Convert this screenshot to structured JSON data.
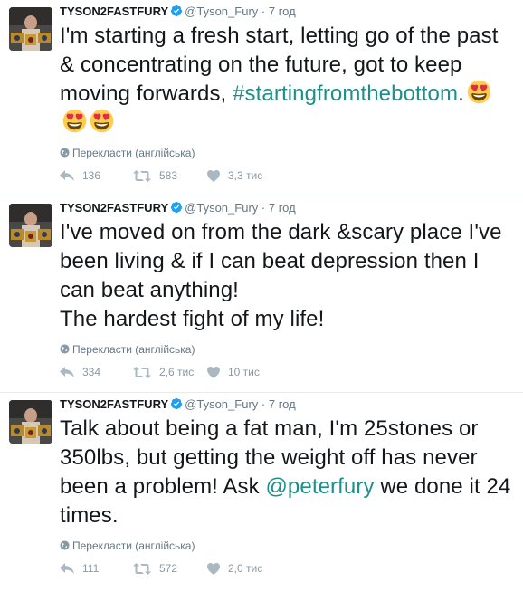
{
  "tweets": [
    {
      "name": "TYSON2FASTFURY",
      "handle": "@Tyson_Fury",
      "sep": "·",
      "time": "7 год",
      "text_before": "I'm starting a fresh start, letting go of the past & concentrating on the future, got to keep moving forwards, ",
      "hashtag": "#startingfromthebottom",
      "text_after": ".",
      "emoji_count": 3,
      "emoji": "smiling-face-with-heart-eyes",
      "translate": "Перекласти (англійська)",
      "replies": "136",
      "retweets": "583",
      "likes": "3,3 тис"
    },
    {
      "name": "TYSON2FASTFURY",
      "handle": "@Tyson_Fury",
      "sep": "·",
      "time": "7 год",
      "line1": "I've moved on from the dark &scary place I've been living & if I can beat depression then I can beat anything!",
      "line2": "The hardest fight of my life!",
      "translate": "Перекласти (англійська)",
      "replies": "334",
      "retweets": "2,6 тис",
      "likes": "10 тис"
    },
    {
      "name": "TYSON2FASTFURY",
      "handle": "@Tyson_Fury",
      "sep": "·",
      "time": "7 год",
      "text_before": "Talk about being a fat man, I'm 25stones or 350lbs, but getting the weight off has never been a problem! Ask ",
      "mention": "@peterfury",
      "text_after": " we done it 24 times.",
      "translate": "Перекласти (англійська)",
      "replies": "111",
      "retweets": "572",
      "likes": "2,0 тис"
    }
  ],
  "colors": {
    "link": "#1d8f8a",
    "muted": "#657786",
    "verified": "#1da1f2"
  }
}
